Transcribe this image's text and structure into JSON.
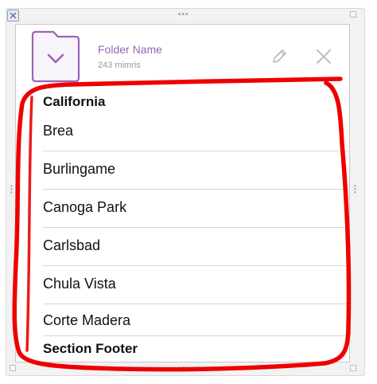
{
  "folder": {
    "name": "Folder Name",
    "subtitle": "243 mimris",
    "accent": "#9b63b7"
  },
  "section": {
    "header": "California",
    "footer": "Section Footer",
    "items": [
      {
        "label": "Brea"
      },
      {
        "label": "Burlingame"
      },
      {
        "label": "Canoga Park"
      },
      {
        "label": "Carlsbad"
      },
      {
        "label": "Chula Vista"
      },
      {
        "label": "Corte Madera"
      }
    ]
  },
  "icons": {
    "folder": "folder-icon",
    "edit": "pencil-icon",
    "close": "close-icon",
    "window_close": "window-close-icon",
    "drag": "drag-handle-icon"
  },
  "colors": {
    "annotation": "#ee0000"
  }
}
